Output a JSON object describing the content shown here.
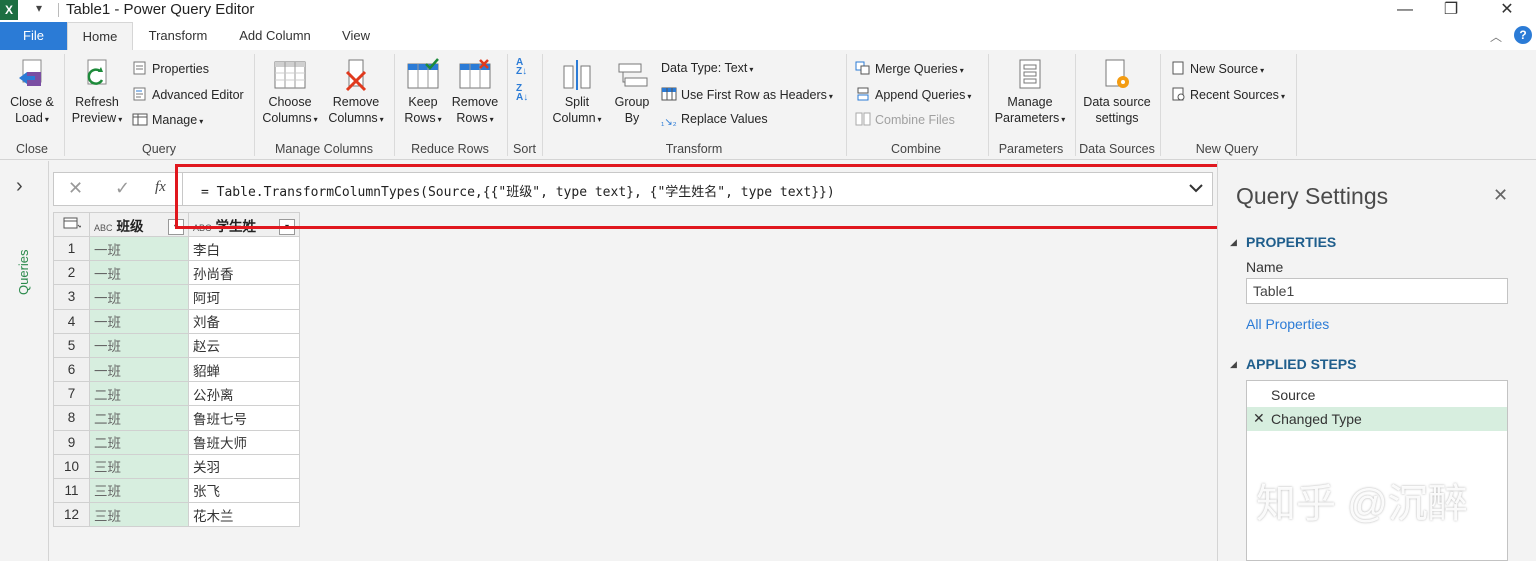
{
  "window": {
    "title": "Table1 - Power Query Editor",
    "app_icon_letter": "X",
    "qat_symbol": "▾",
    "minimize": "—",
    "maximize": "❐",
    "close": "✕"
  },
  "tabs": {
    "file": "File",
    "home": "Home",
    "transform": "Transform",
    "add_column": "Add Column",
    "view": "View",
    "help": "?"
  },
  "ribbon": {
    "close_group": {
      "label": "Close",
      "close_load_line1": "Close &",
      "close_load_line2": "Load"
    },
    "query_group": {
      "label": "Query",
      "refresh_line1": "Refresh",
      "refresh_line2": "Preview",
      "properties": "Properties",
      "advanced_editor": "Advanced Editor",
      "manage": "Manage"
    },
    "manage_columns_group": {
      "label": "Manage Columns",
      "choose_line1": "Choose",
      "choose_line2": "Columns",
      "remove_line1": "Remove",
      "remove_line2": "Columns"
    },
    "reduce_rows_group": {
      "label": "Reduce Rows",
      "keep_line1": "Keep",
      "keep_line2": "Rows",
      "remove_line1": "Remove",
      "remove_line2": "Rows"
    },
    "sort_group": {
      "label": "Sort"
    },
    "transform_group": {
      "label": "Transform",
      "split_line1": "Split",
      "split_line2": "Column",
      "group_line1": "Group",
      "group_line2": "By",
      "data_type": "Data Type: Text",
      "first_row_headers": "Use First Row as Headers",
      "replace_values": "Replace Values"
    },
    "combine_group": {
      "label": "Combine",
      "merge_queries": "Merge Queries",
      "append_queries": "Append Queries",
      "combine_files": "Combine Files"
    },
    "parameters_group": {
      "label": "Parameters",
      "manage_line1": "Manage",
      "manage_line2": "Parameters"
    },
    "data_sources_group": {
      "label": "Data Sources",
      "ds_line1": "Data source",
      "ds_line2": "settings"
    },
    "new_query_group": {
      "label": "New Query",
      "new_source": "New Source",
      "recent_sources": "Recent Sources"
    }
  },
  "left_pane": {
    "toggle": "›",
    "queries_label": "Queries"
  },
  "formula_bar": {
    "cancel_icon": "✕",
    "commit_icon": "✓",
    "fx_label": "fx",
    "formula": "= Table.TransformColumnTypes(Source,{{\"班级\", type text}, {\"学生姓名\", type text}})"
  },
  "grid": {
    "type_badge": "ABC",
    "columns": [
      "班级",
      "学生姓"
    ],
    "rows": [
      {
        "n": "1",
        "c1": "一班",
        "c2": "李白"
      },
      {
        "n": "2",
        "c1": "一班",
        "c2": "孙尚香"
      },
      {
        "n": "3",
        "c1": "一班",
        "c2": "阿珂"
      },
      {
        "n": "4",
        "c1": "一班",
        "c2": "刘备"
      },
      {
        "n": "5",
        "c1": "一班",
        "c2": "赵云"
      },
      {
        "n": "6",
        "c1": "一班",
        "c2": "貂蝉"
      },
      {
        "n": "7",
        "c1": "二班",
        "c2": "公孙离"
      },
      {
        "n": "8",
        "c1": "二班",
        "c2": "鲁班七号"
      },
      {
        "n": "9",
        "c1": "二班",
        "c2": "鲁班大师"
      },
      {
        "n": "10",
        "c1": "三班",
        "c2": "关羽"
      },
      {
        "n": "11",
        "c1": "三班",
        "c2": "张飞"
      },
      {
        "n": "12",
        "c1": "三班",
        "c2": "花木兰"
      }
    ]
  },
  "query_settings": {
    "title": "Query Settings",
    "close": "✕",
    "properties_header": "PROPERTIES",
    "name_label": "Name",
    "name_value": "Table1",
    "all_properties": "All Properties",
    "applied_steps_header": "APPLIED STEPS",
    "steps": [
      "Source",
      "Changed Type"
    ],
    "step_delete_icon": "✕"
  },
  "watermark": "知乎 @沉醉",
  "colors": {
    "accent": "#2b7bd6",
    "excel_green": "#1d6f42",
    "highlight_red": "#e0171e",
    "column_fill": "#d7eedf",
    "step_selected": "#d7eedf"
  }
}
